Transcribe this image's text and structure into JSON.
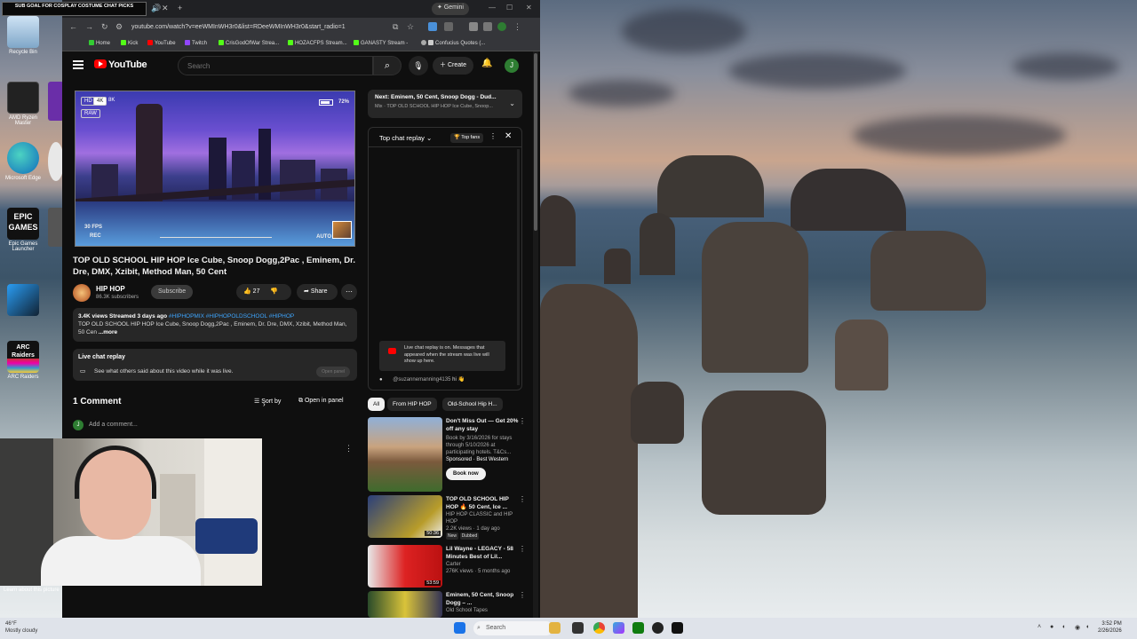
{
  "overlay": {
    "goal_text": "SUB GOAL FOR COSPLAY COSTUME CHAT PICKS"
  },
  "desktop": {
    "icons": [
      {
        "label": "Recycle Bin"
      },
      {
        "label": "AMD Ryzen Master"
      },
      {
        "label": "Microsoft Edge"
      },
      {
        "label": "Epic Games Launcher"
      },
      {
        "label": "ARC Raiders"
      }
    ],
    "learn_text": "Learn about this picture"
  },
  "browser": {
    "tab_gemini": "Gemini",
    "url": "youtube.com/watch?v=eeWMInWH3r0&list=RDeeWMInWH3r0&start_radio=1",
    "bookmarks": [
      "Home",
      "Kick",
      "YouTube",
      "Twitch",
      "CrisGodOfWar Strea...",
      "HOZACFPS Stream...",
      "GANASTY Stream -",
      "Confucius Quotes (..."
    ]
  },
  "youtube": {
    "logo": "YouTube",
    "search_placeholder": "Search",
    "create_label": "Create",
    "avatar_letter": "J",
    "player": {
      "hud_hd": "HD",
      "hud_4k": "4K",
      "hud_8k": "8K",
      "hud_raw": "RAW",
      "battery": "72%",
      "fps": "30 FPS",
      "rec": "REC",
      "auto": "AUTO"
    },
    "video_title": "TOP OLD SCHOOL HIP HOP Ice Cube, Snoop Dogg,2Pac , Eminem, Dr. Dre, DMX, Xzibit, Method Man, 50 Cent",
    "channel_name": "HIP HOP",
    "channel_subs": "86.3K subscribers",
    "subscribe_label": "Subscribe",
    "likes": "27",
    "share_label": "Share",
    "description": {
      "stats": "3.4K views  Streamed 3 days ago",
      "tags": "#HIPHOPMIX #HIPHOPOLDSCHOOL #HIPHOP",
      "text": "TOP OLD SCHOOL HIP HOP Ice Cube, Snoop Dogg,2Pac , Eminem, Dr. Dre, DMX, Xzibit, Method Man, 50 Cen",
      "more": "...more"
    },
    "live_chat_replay": {
      "title": "Live chat replay",
      "subtitle": "See what others said about this video while it was live.",
      "button": "Open panel"
    },
    "comments_header": "1 Comment",
    "sort_by": "Sort by",
    "open_in_panel": "Open in panel",
    "add_comment_placeholder": "Add a comment...",
    "next_up": {
      "title": "Next: Eminem, 50 Cent, Snoop Dogg - Dud...",
      "subtitle": "Mix · TOP OLD SCHOOL HIP HOP Ice Cube, Snoop..."
    },
    "chat": {
      "title": "Top chat replay",
      "top_fans": "Top fans",
      "notice": "Live chat replay is on. Messages that appeared when the stream was live will show up here.",
      "message_user": "@suzannemanning4135",
      "message_text": "hi 👋"
    },
    "chips": [
      "All",
      "From HIP HOP",
      "Old-School Hip H..."
    ],
    "recommendations": [
      {
        "title": "Don't Miss Out — Get 20% off any stay",
        "meta1": "Book by 3/16/2026 for stays through 5/10/2026 at participating hotels. T&Cs...",
        "meta2": "Sponsored · Best Western",
        "cta": "Book now"
      },
      {
        "title": "TOP OLD SCHOOL HIP HOP 🔥 50 Cent, Ice ...",
        "meta1": "HIP HOP CLASSIC and HIP HOP",
        "meta2": "2.2K views · 1 day ago",
        "badge1": "New",
        "badge2": "Dubbed",
        "duration": "50:36"
      },
      {
        "title": "Lil Wayne - LEGACY - 58 Minutes Best of Lil...",
        "meta1": "Carter",
        "meta2": "276K views · 5 months ago",
        "duration": "53:59"
      },
      {
        "title": "Eminem, 50 Cent, Snoop Dogg – ...",
        "meta1": "Old School Tapes"
      }
    ]
  },
  "taskbar": {
    "weather_temp": "46°F",
    "weather_desc": "Mostly cloudy",
    "search_label": "Search",
    "time": "3:52 PM",
    "date": "2/26/2026"
  }
}
